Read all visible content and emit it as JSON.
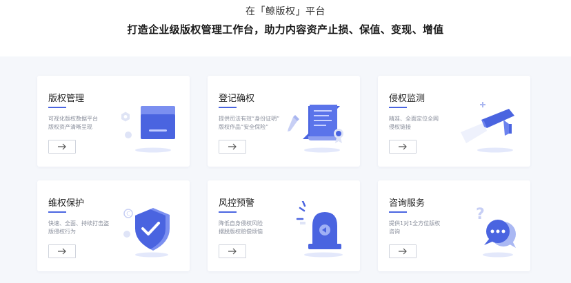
{
  "header": {
    "subtitle": "在「鲸版权」平台",
    "title": "打造企业级版权管理工作台，助力内容资产止损、保值、变现、增值"
  },
  "colors": {
    "accent": "#4a64e0",
    "accent_light": "#dfe4fb",
    "stage_bg": "#f5f7fb"
  },
  "cards": [
    {
      "title": "版权管理",
      "desc": [
        "可视化版权数据平台",
        "版权资产清晰呈现"
      ],
      "icon": "folder-box-icon"
    },
    {
      "title": "登记确权",
      "desc": [
        "提供司法有效“身份证明”",
        "版权作品“安全保险”"
      ],
      "icon": "certificate-icon"
    },
    {
      "title": "侵权监测",
      "desc": [
        "精准、全面定位全网",
        "侵权链接"
      ],
      "icon": "surveillance-camera-icon"
    },
    {
      "title": "维权保护",
      "desc": [
        "快速、全面、持续打击盗",
        "版侵权行为"
      ],
      "icon": "shield-check-icon"
    },
    {
      "title": "风控预警",
      "desc": [
        "降低自身侵权风险",
        "摆脱版权赔偿烦恼"
      ],
      "icon": "alarm-siren-icon"
    },
    {
      "title": "咨询服务",
      "desc": [
        "提供1对1全方位版权",
        "咨询"
      ],
      "icon": "chat-bubble-icon"
    }
  ]
}
